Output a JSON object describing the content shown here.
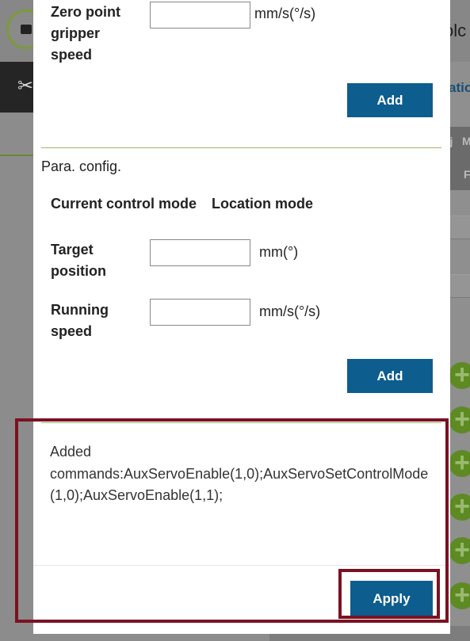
{
  "background": {
    "header_partial_text": "olc",
    "panel_partial_label": "atio",
    "table_partial_headers": [
      "oj",
      "M",
      "F"
    ]
  },
  "modal": {
    "zero_point_speed": {
      "label_lines": [
        "Zero point",
        "gripper",
        "speed"
      ],
      "value": "",
      "unit": "mm/s(°/s)",
      "add_label": "Add"
    },
    "para_config": {
      "title": "Para. config.",
      "current_mode_label": "Current control mode",
      "current_mode_value": "Location mode",
      "target_position": {
        "label_lines": [
          "Target",
          "position"
        ],
        "value": "",
        "unit": "mm(°)"
      },
      "running_speed": {
        "label_lines": [
          "Running",
          "speed"
        ],
        "value": "",
        "unit": "mm/s(°/s)"
      },
      "add_label": "Add"
    },
    "added_commands": {
      "line1": "Added",
      "line2": "commands:AuxServoEnable(1,0);AuxServoSetControlMode(1,0);AuxServoEnable(1,1);"
    },
    "apply_label": "Apply"
  },
  "colors": {
    "button_bg": "#0d5d8e",
    "divider": "#a0b86a",
    "highlight_border": "#7a1222",
    "overlay": "#8c8c8c"
  }
}
